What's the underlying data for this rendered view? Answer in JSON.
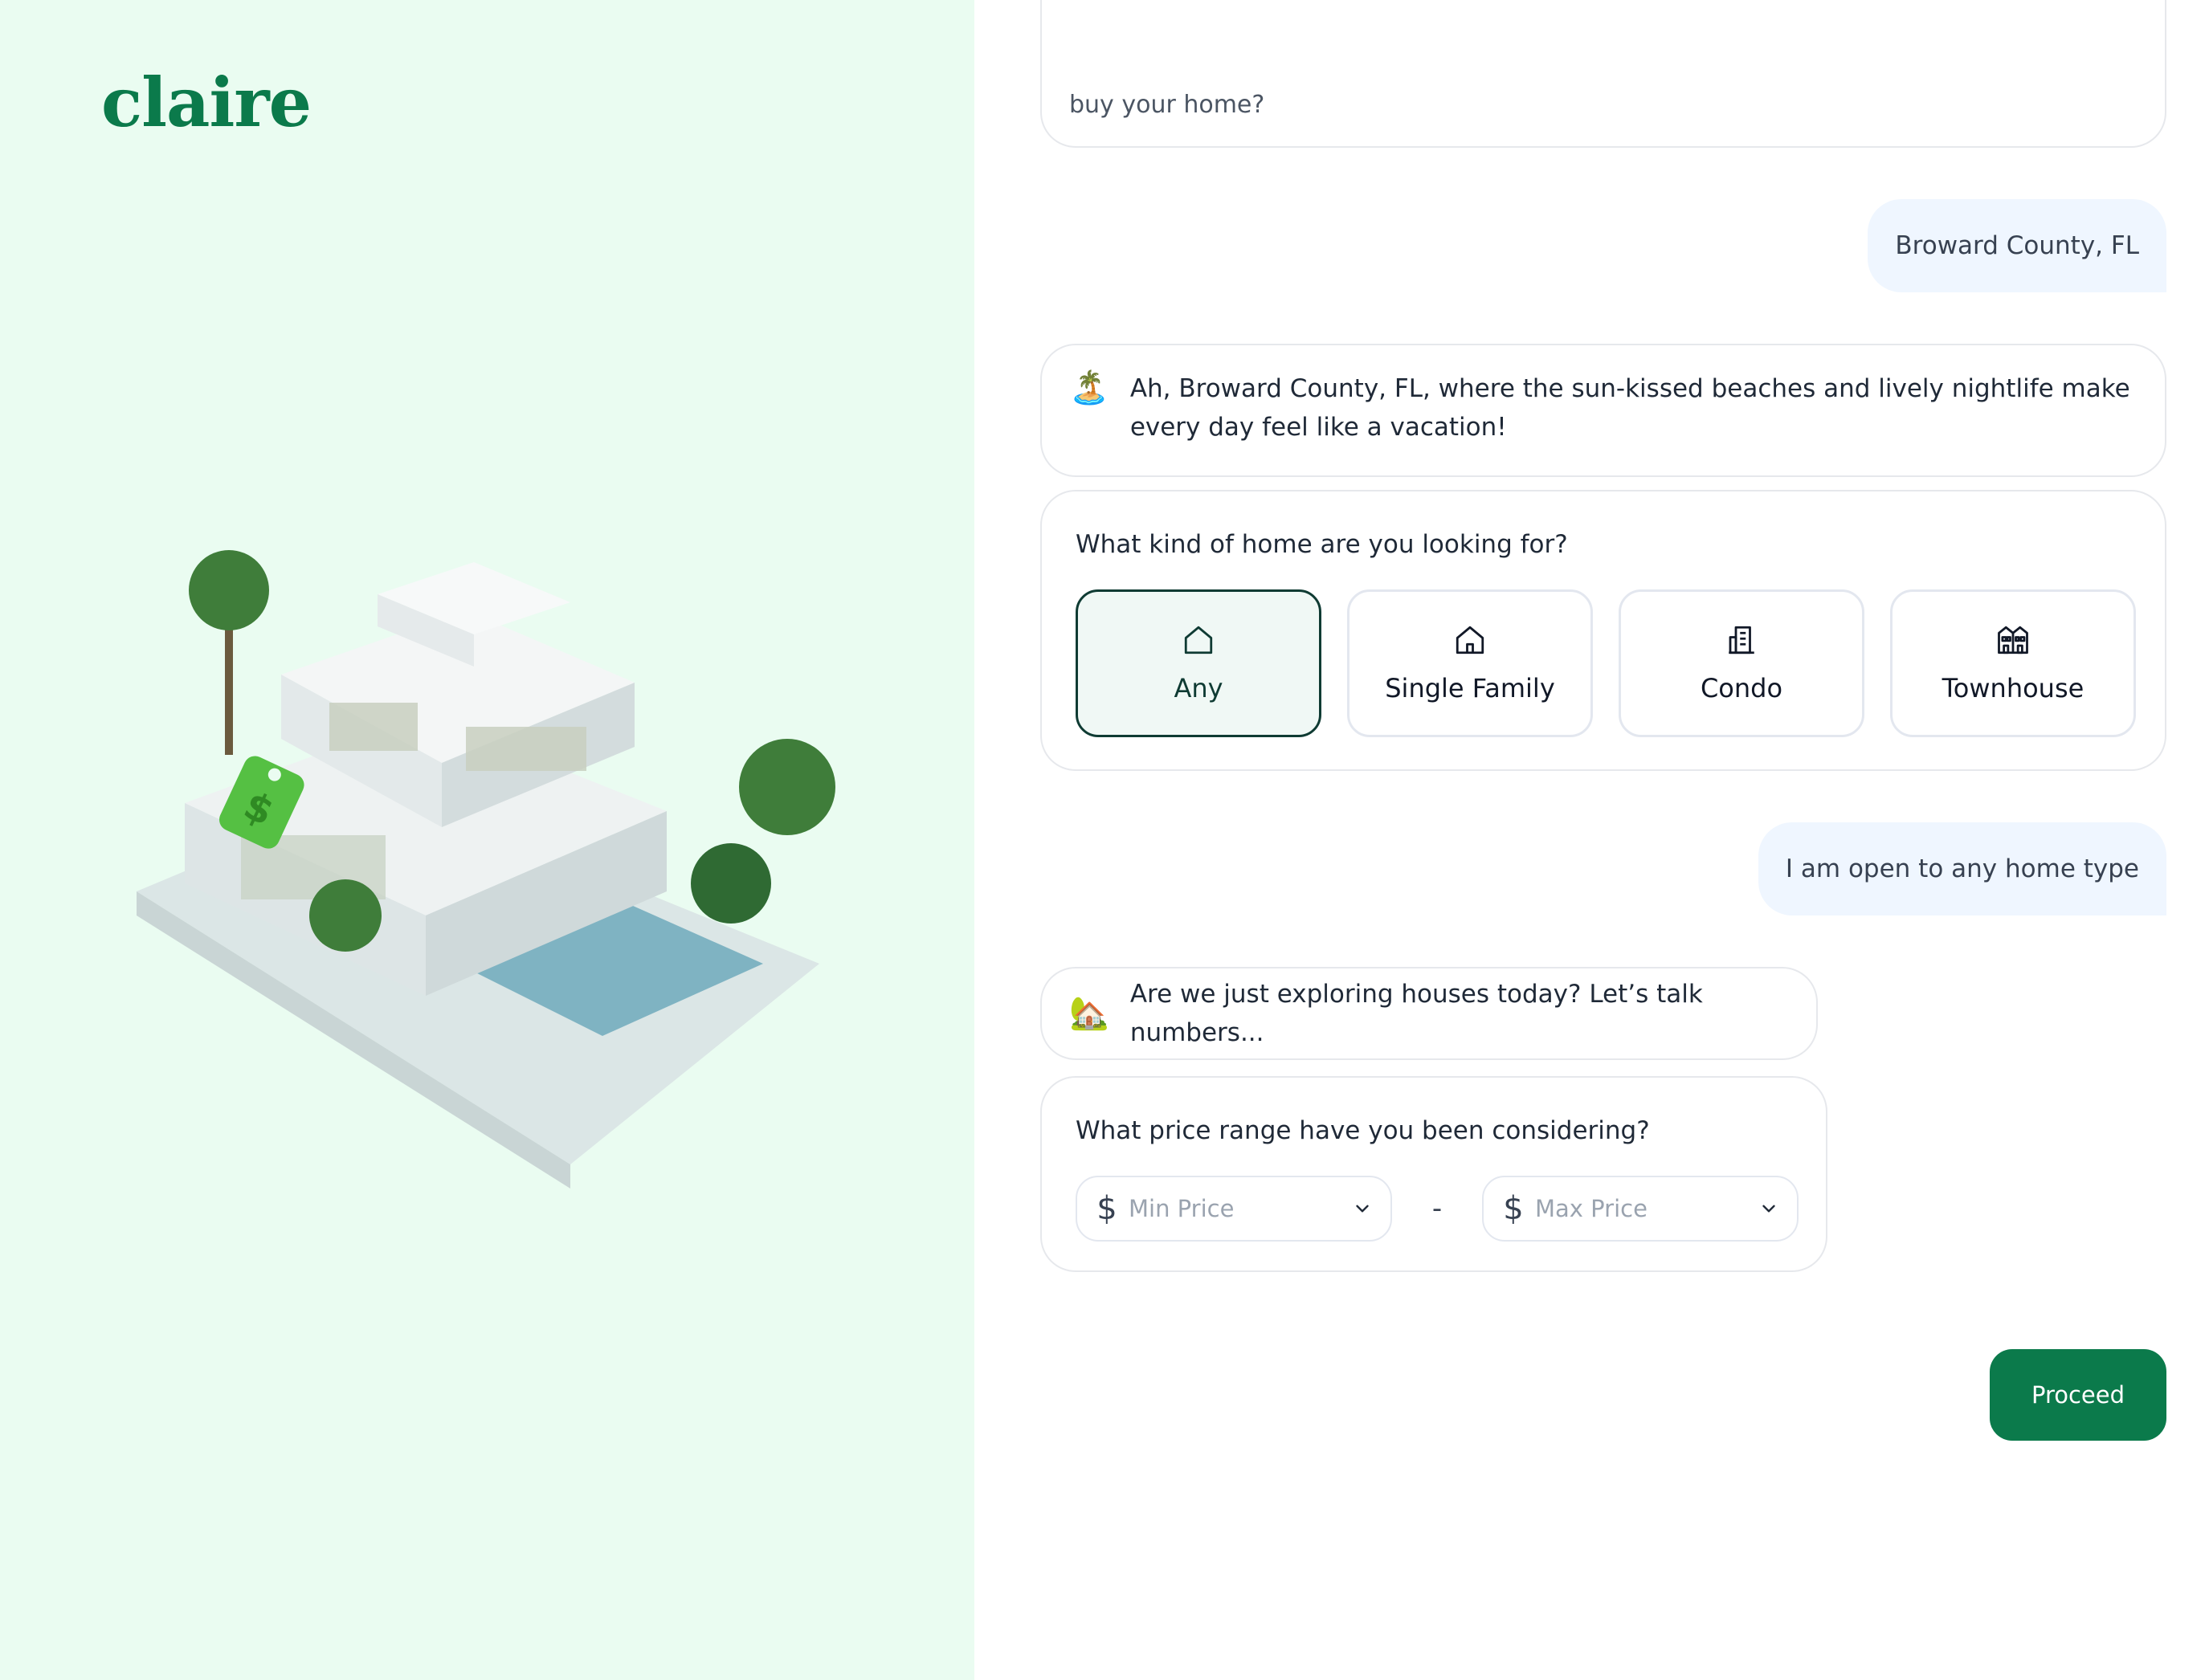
{
  "brand": {
    "logo_text": "claire",
    "accent": "#0b7a4b"
  },
  "chat": {
    "previous_question_fragment": "buy your home?",
    "user_location_reply": "Broward County, FL",
    "bot_location_emoji": "🏝️",
    "bot_location_message": "Ah, Broward County, FL, where the sun-kissed beaches and lively nightlife make every day feel like a vacation!",
    "home_type_question": "What kind of home are you looking for?",
    "home_type_options": [
      {
        "label": "Any",
        "icon": "house-outline-icon",
        "selected": true
      },
      {
        "label": "Single Family",
        "icon": "single-family-home-icon",
        "selected": false
      },
      {
        "label": "Condo",
        "icon": "condo-building-icon",
        "selected": false
      },
      {
        "label": "Townhouse",
        "icon": "townhouse-icon",
        "selected": false
      }
    ],
    "user_home_type_reply": "I am open to any home type",
    "bot_explore_emoji": "🏡",
    "bot_explore_message": "Are we just exploring houses today? Let’s talk numbers...",
    "price_question": "What price range have you been considering?",
    "price": {
      "min_placeholder": "Min Price",
      "max_placeholder": "Max Price",
      "separator": "-",
      "currency_symbol": "$"
    }
  },
  "actions": {
    "proceed_label": "Proceed"
  },
  "colors": {
    "left_panel_bg": "#eafcf1",
    "user_bubble_bg": "#eff6ff",
    "selected_border": "#0f3b33",
    "button_bg": "#0b7a4b"
  }
}
